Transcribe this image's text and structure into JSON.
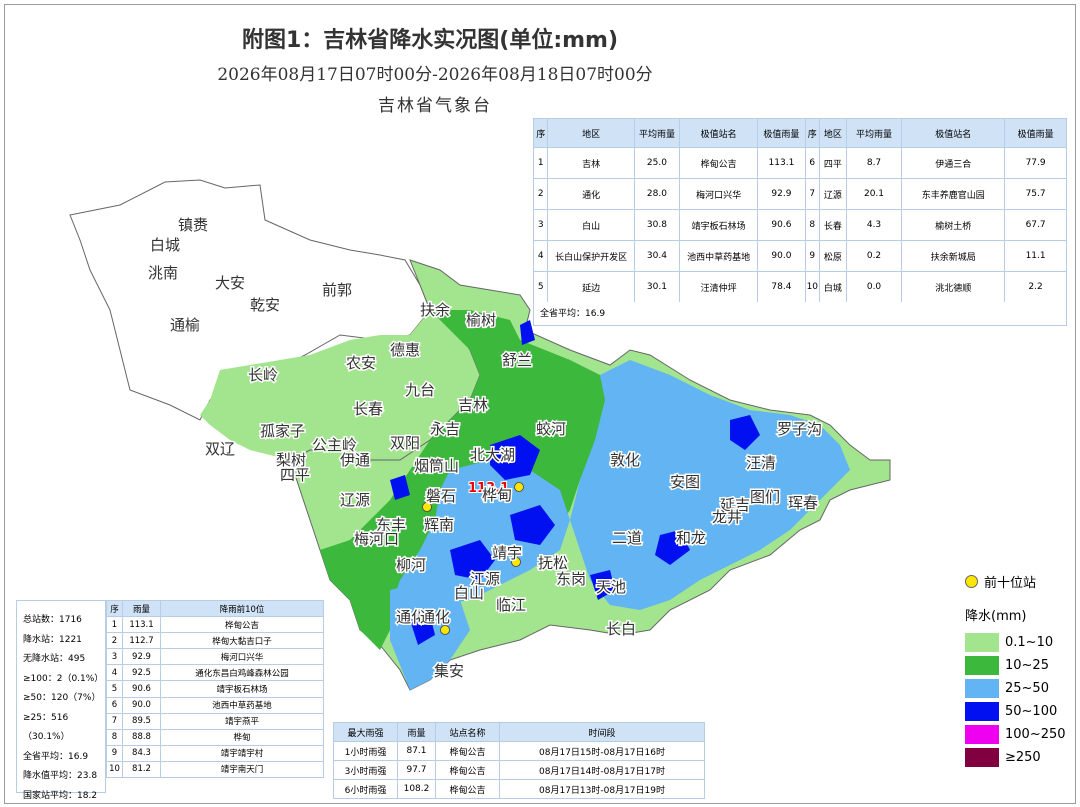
{
  "header": {
    "title": "附图1：吉林省降水实况图(单位:mm)",
    "period": "2026年08月17日07时00分-2026年08月18日07时00分",
    "org": "吉林省气象台"
  },
  "region_table": {
    "headers": [
      "序",
      "地区",
      "平均雨量",
      "极值站名",
      "极值雨量",
      "序",
      "地区",
      "平均雨量",
      "极值站名",
      "极值雨量"
    ],
    "rows": [
      [
        "1",
        "吉林",
        "25.0",
        "桦甸公吉",
        "113.1",
        "6",
        "四平",
        "8.7",
        "伊通三合",
        "77.9"
      ],
      [
        "2",
        "通化",
        "28.0",
        "梅河口兴华",
        "92.9",
        "7",
        "辽源",
        "20.1",
        "东丰养鹿官山园",
        "75.7"
      ],
      [
        "3",
        "白山",
        "30.8",
        "靖宇板石林场",
        "90.6",
        "8",
        "长春",
        "4.3",
        "榆树土桥",
        "67.7"
      ],
      [
        "4",
        "长白山保护开发区",
        "30.4",
        "池西中草药基地",
        "90.0",
        "9",
        "松原",
        "0.2",
        "扶余新城局",
        "11.1"
      ],
      [
        "5",
        "延边",
        "30.1",
        "汪清仲坪",
        "78.4",
        "10",
        "白城",
        "0.0",
        "洮北德顺",
        "2.2"
      ]
    ],
    "footer": "全省平均：16.9"
  },
  "stats": [
    "总站数：1716",
    "降水站：1221",
    "无降水站：495",
    "≥100：2（0.1%）",
    "≥50：120（7%）",
    "≥25：516（30.1%）",
    "全省平均：16.9",
    "降水值平均：23.8",
    "国家站平均：18.2"
  ],
  "top10": {
    "headers": [
      "序",
      "雨量",
      "降雨前10位"
    ],
    "rows": [
      [
        "1",
        "113.1",
        "桦甸公吉"
      ],
      [
        "2",
        "112.7",
        "桦甸大黏吉口子"
      ],
      [
        "3",
        "92.9",
        "梅河口兴华"
      ],
      [
        "4",
        "92.5",
        "通化东昌白鸡峰森林公园"
      ],
      [
        "5",
        "90.6",
        "靖宇板石林场"
      ],
      [
        "6",
        "90.0",
        "池西中草药基地"
      ],
      [
        "7",
        "89.5",
        "靖宇燕平"
      ],
      [
        "8",
        "88.8",
        "桦甸"
      ],
      [
        "9",
        "84.3",
        "靖宇靖宇村"
      ],
      [
        "10",
        "81.2",
        "靖宇南天门"
      ]
    ]
  },
  "rain_intensity": {
    "headers": [
      "最大雨强",
      "雨量",
      "站点名称",
      "时间段"
    ],
    "rows": [
      [
        "1小时雨强",
        "87.1",
        "桦甸公吉",
        "08月17日15时-08月17日16时"
      ],
      [
        "3小时雨强",
        "97.7",
        "桦甸公吉",
        "08月17日14时-08月17日17时"
      ],
      [
        "6小时雨强",
        "108.2",
        "桦甸公吉",
        "08月17日13时-08月17日19时"
      ]
    ]
  },
  "legend": {
    "station_label": "前十位站",
    "title": "降水(mm)",
    "items": [
      {
        "label": "0.1~10",
        "color": "#a3e48f"
      },
      {
        "label": "10~25",
        "color": "#3cb83c"
      },
      {
        "label": "25~50",
        "color": "#62b4f2"
      },
      {
        "label": "50~100",
        "color": "#0010f0"
      },
      {
        "label": "100~250",
        "color": "#f000f0"
      },
      {
        "label": "≥250",
        "color": "#800040"
      }
    ]
  },
  "map": {
    "peak_label": "113.1",
    "places": [
      "镇赉",
      "白城",
      "洮南",
      "大安",
      "乾安",
      "前郭",
      "扶余",
      "榆树",
      "通榆",
      "农安",
      "德惠",
      "舒兰",
      "长岭",
      "九台",
      "长春",
      "吉林",
      "蛟河",
      "双辽",
      "孤家子",
      "公主岭",
      "双阳",
      "永吉",
      "梨树",
      "伊通",
      "烟筒山",
      "北大湖",
      "四平",
      "敦化",
      "罗子沟",
      "汪清",
      "辽源",
      "磐石",
      "桦甸",
      "安图",
      "延吉",
      "图们",
      "龙井",
      "珲春",
      "东丰",
      "辉南",
      "梅河口",
      "二道",
      "和龙",
      "柳河",
      "靖宇",
      "抚松",
      "江源",
      "东岗",
      "天池",
      "白山",
      "临江",
      "通化",
      "通化",
      "长白",
      "集安"
    ]
  }
}
